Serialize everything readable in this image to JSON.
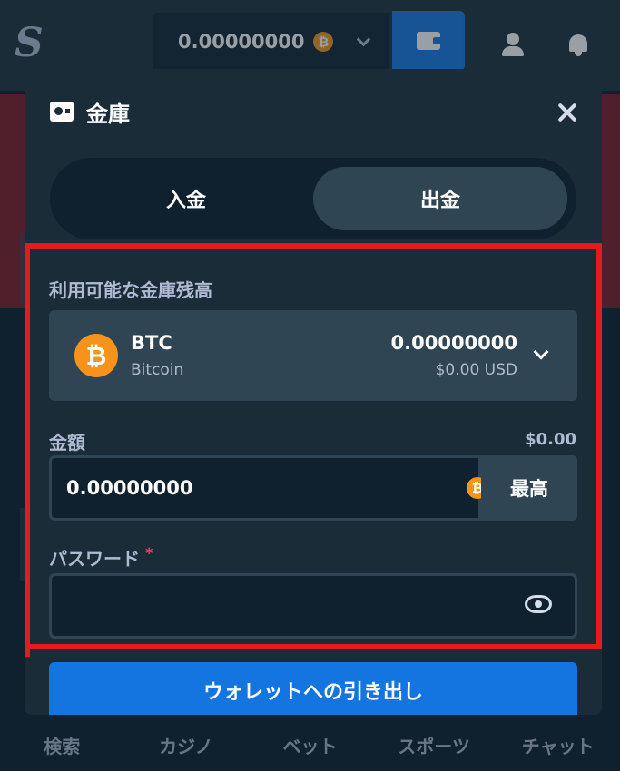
{
  "app": {
    "logo_text": "S",
    "balance_value": "0.00000000",
    "coin_symbol": "₿"
  },
  "bottom_nav": [
    "検索",
    "カジノ",
    "ベット",
    "スポーツ",
    "チャット"
  ],
  "modal": {
    "title": "金庫",
    "tabs": [
      {
        "label": "入金",
        "active": false
      },
      {
        "label": "出金",
        "active": true
      }
    ],
    "available_label": "利用可能な金庫残高",
    "currency": {
      "code": "BTC",
      "name": "Bitcoin",
      "symbol": "₿",
      "amount": "0.00000000",
      "usd": "$0.00 USD"
    },
    "amount_label": "金額",
    "amount_usd": "$0.00",
    "amount_value": "0.00000000",
    "max_label": "最高",
    "password_label": "パスワード",
    "password_required_mark": "*",
    "password_value": "",
    "withdraw_label": "ウォレットへの引き出し"
  },
  "colors": {
    "background": "#0f212e",
    "panel": "#1a2c38",
    "surface": "#2f4553",
    "accent": "#1475e1",
    "btc": "#f7931a",
    "highlight": "#e21c1c"
  }
}
